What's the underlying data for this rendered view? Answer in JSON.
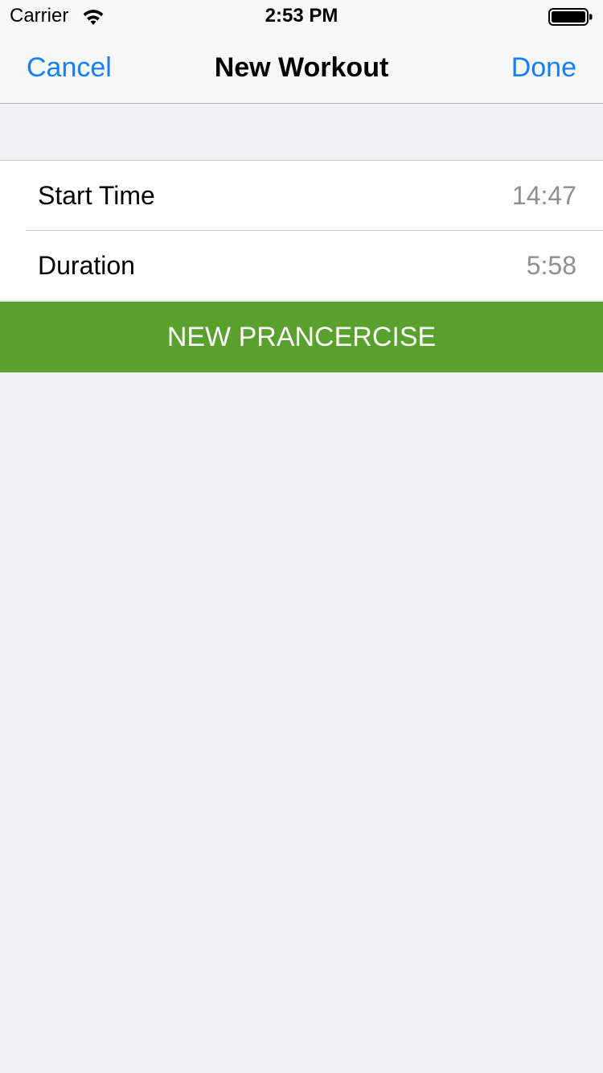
{
  "status_bar": {
    "carrier": "Carrier",
    "time": "2:53 PM",
    "wifi_icon": "wifi-icon",
    "battery_icon": "battery-icon"
  },
  "nav_bar": {
    "cancel_label": "Cancel",
    "title": "New Workout",
    "done_label": "Done"
  },
  "form": {
    "rows": [
      {
        "label": "Start Time",
        "value": "14:47"
      },
      {
        "label": "Duration",
        "value": "5:58"
      }
    ]
  },
  "action": {
    "label": "NEW PRANCERCISE"
  },
  "colors": {
    "accent_blue": "#147efb",
    "action_green": "#59a02d",
    "background": "#efeff4",
    "value_gray": "#8e8e93"
  }
}
